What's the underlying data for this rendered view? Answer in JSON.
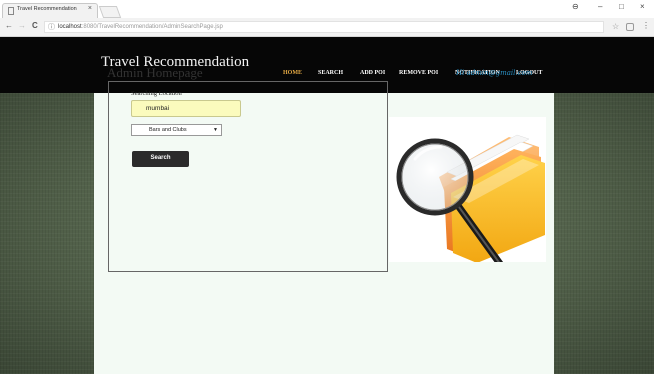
{
  "browser": {
    "tab_title": "Travel Recommendation",
    "tab_close": "×",
    "back": "←",
    "forward": "→",
    "reload": "C",
    "info_icon": "ⓘ",
    "url_host": "localhost",
    "url_rest": ":8080/TravelRecommendation/AdminSearchPage.jsp",
    "star": "☆",
    "menu": "⋮",
    "account": "⊖",
    "minimize": "–",
    "maximize": "□",
    "close": "×"
  },
  "header": {
    "site_title": "Travel Recommendation",
    "nav": [
      "HOME",
      "SEARCH",
      "ADD POI",
      "REMOVE POI",
      "NOTIFICATION",
      "LOGOUT"
    ],
    "active_nav": "HOME"
  },
  "main": {
    "title": "Admin Homepage",
    "email": "Hi admin@gmail.com",
    "search_label": "Searching Location",
    "search_value": "mumbai",
    "category_value": "Bars and Clubs",
    "category_arrow": "▼",
    "search_button": "Search"
  },
  "colors": {
    "header_bg": "#060606",
    "active_nav": "#e2a743",
    "panel_bg": "#f3faf4",
    "input_bg": "#fbfbbd",
    "email": "#2a8fc2",
    "button_bg": "#2b2b2b"
  },
  "icons": [
    "tab-page-icon",
    "back-icon",
    "forward-icon",
    "reload-icon",
    "info-icon",
    "star-icon",
    "extension-icon",
    "menu-icon",
    "folder-magnifier-illustration"
  ]
}
